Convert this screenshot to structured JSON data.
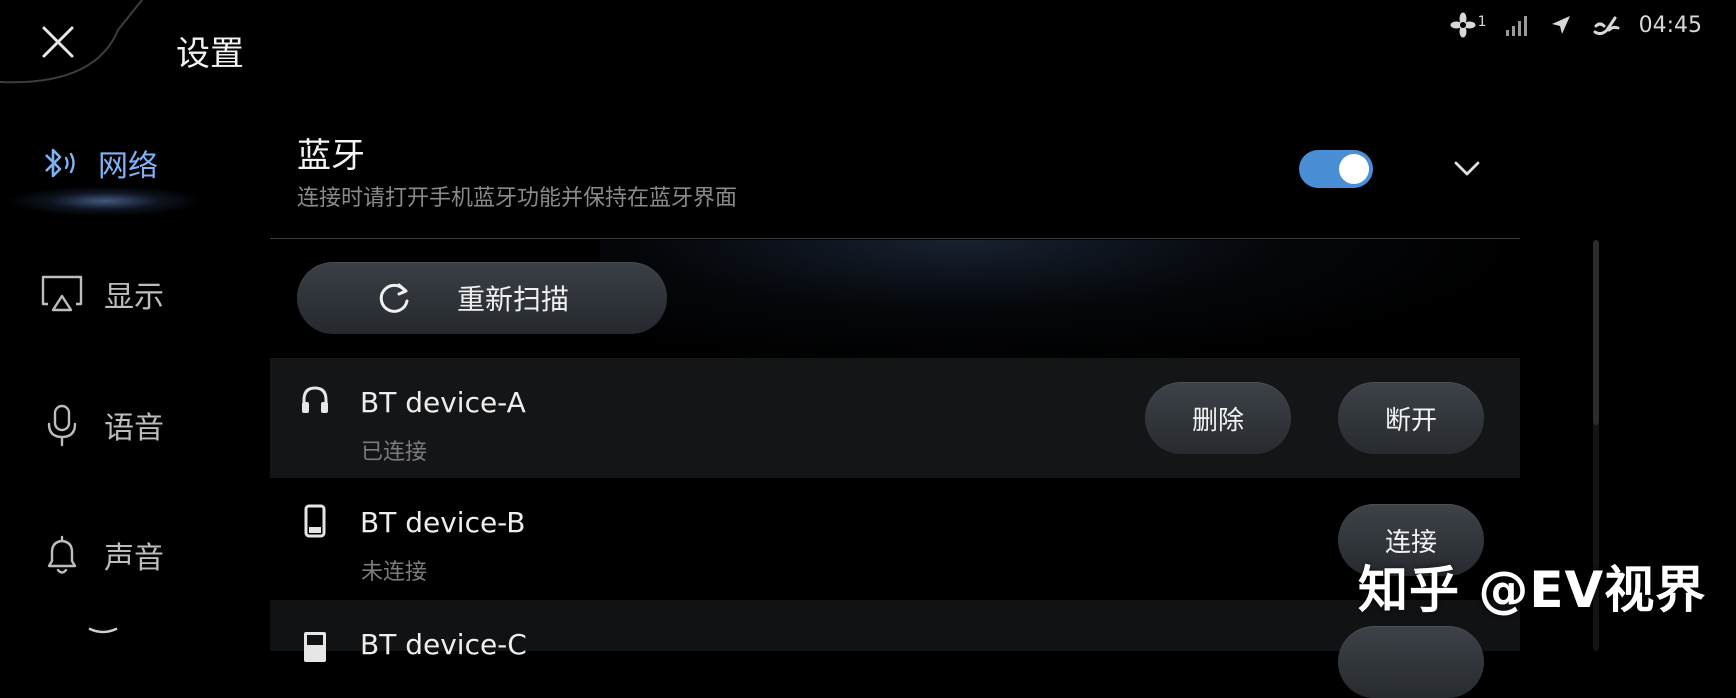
{
  "header": {
    "title": "设置"
  },
  "status_bar": {
    "fan_level": "1",
    "time": "04:45"
  },
  "sidebar": {
    "items": [
      {
        "label": "网络",
        "icon": "bluetooth-icon",
        "active": true
      },
      {
        "label": "显示",
        "icon": "screen-cast-icon",
        "active": false
      },
      {
        "label": "语音",
        "icon": "microphone-icon",
        "active": false
      },
      {
        "label": "声音",
        "icon": "bell-icon",
        "active": false
      }
    ]
  },
  "bluetooth": {
    "title": "蓝牙",
    "subtitle": "连接时请打开手机蓝牙功能并保持在蓝牙界面",
    "enabled": true,
    "rescan_label": "重新扫描",
    "devices": [
      {
        "name": "BT device-A",
        "status": "已连接",
        "icon": "headphones-icon",
        "actions": [
          "删除",
          "断开"
        ]
      },
      {
        "name": "BT device-B",
        "status": "未连接",
        "icon": "phone-icon",
        "actions": [
          "连接"
        ]
      },
      {
        "name": "BT device-C",
        "icon": "device-icon"
      }
    ]
  },
  "colors": {
    "accent": "#4a8fd6",
    "active_nav": "#7fb2f5",
    "background": "#000000"
  },
  "watermark": "知乎 @EV视界"
}
